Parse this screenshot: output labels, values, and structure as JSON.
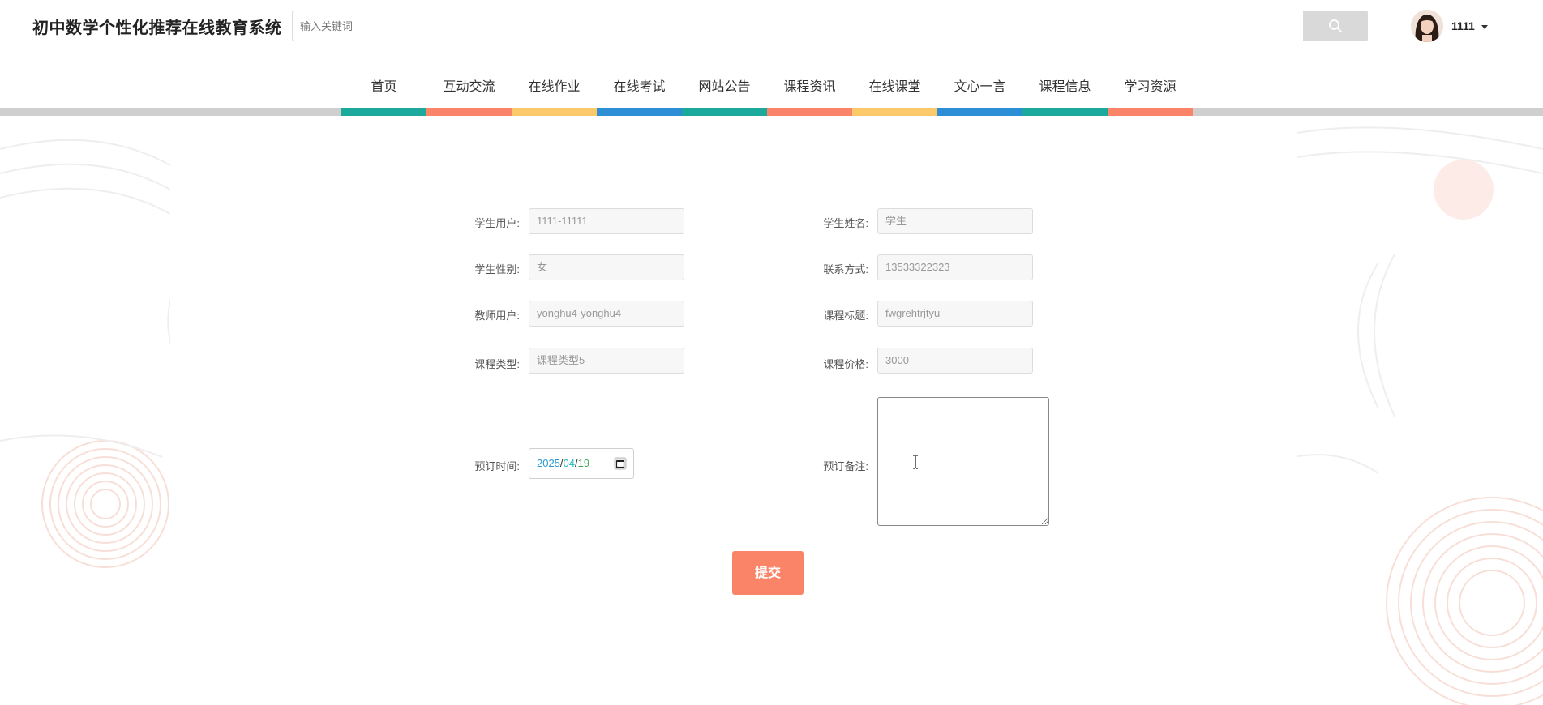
{
  "header": {
    "site_title": "初中数学个性化推荐在线教育系统",
    "search_placeholder": "输入关键词",
    "user_name": "1111"
  },
  "nav": {
    "items": [
      {
        "label": "首页",
        "color": "#1aa99a"
      },
      {
        "label": "互动交流",
        "color": "#f98467"
      },
      {
        "label": "在线作业",
        "color": "#fbc96a"
      },
      {
        "label": "在线考试",
        "color": "#2c8fd6"
      },
      {
        "label": "网站公告",
        "color": "#1aa99a"
      },
      {
        "label": "课程资讯",
        "color": "#f98467"
      },
      {
        "label": "在线课堂",
        "color": "#fbc96a"
      },
      {
        "label": "文心一言",
        "color": "#2c8fd6"
      },
      {
        "label": "课程信息",
        "color": "#1aa99a"
      },
      {
        "label": "学习资源",
        "color": "#f98467"
      }
    ]
  },
  "form": {
    "student_user": {
      "label": "学生用户:",
      "value": "1111-11111"
    },
    "student_name": {
      "label": "学生姓名:",
      "value": "学生"
    },
    "student_gender": {
      "label": "学生性别:",
      "value": "女"
    },
    "contact": {
      "label": "联系方式:",
      "value": "13533322323"
    },
    "teacher_user": {
      "label": "教师用户:",
      "value": "yonghu4-yonghu4"
    },
    "course_title": {
      "label": "课程标题:",
      "value": "fwgrehtrjtyu"
    },
    "course_type": {
      "label": "课程类型:",
      "value": "课程类型5"
    },
    "course_price": {
      "label": "课程价格:",
      "value": "3000"
    },
    "booking_time": {
      "label": "预订时间:",
      "year": "2025",
      "month": "04",
      "day": "19",
      "sep": "/"
    },
    "booking_remark": {
      "label": "预订备注:",
      "value": ""
    },
    "submit_label": "提交"
  },
  "colors": {
    "accent": "#f98467",
    "teal": "#1aa99a",
    "yellow": "#fbc96a",
    "blue": "#2c8fd6"
  }
}
